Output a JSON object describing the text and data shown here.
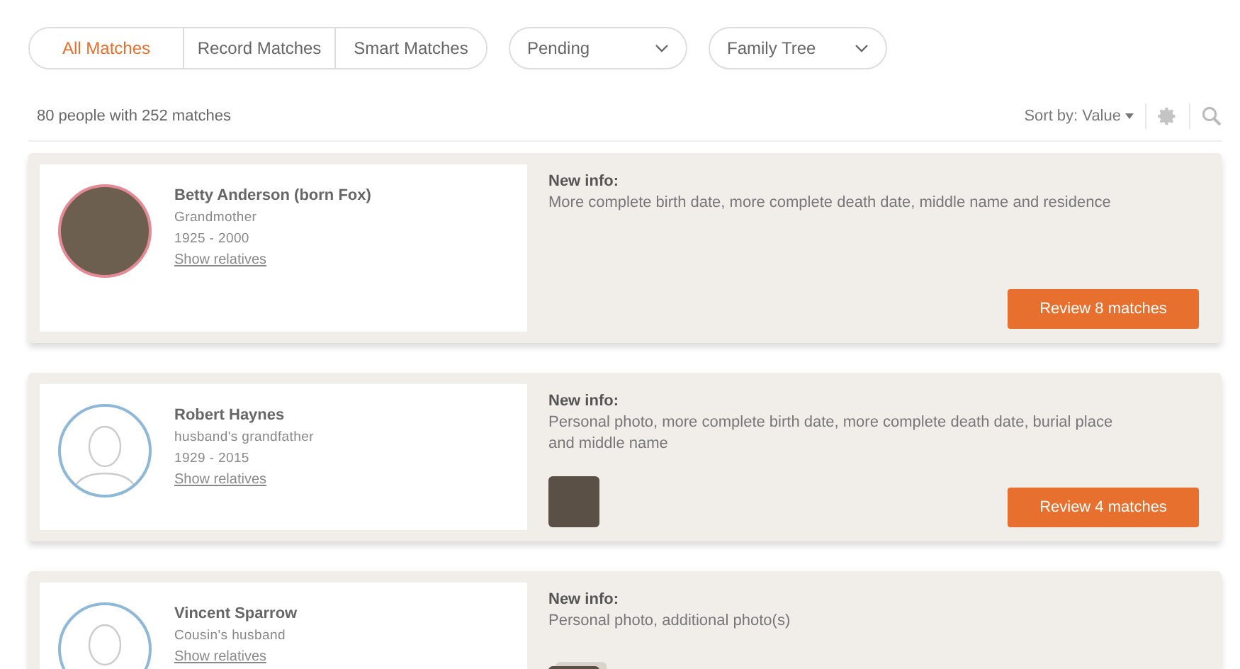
{
  "filter_tabs": [
    {
      "label": "All Matches",
      "selected": true
    },
    {
      "label": "Record Matches",
      "selected": false
    },
    {
      "label": "Smart Matches",
      "selected": false
    }
  ],
  "dropdowns": [
    {
      "label": "Pending"
    },
    {
      "label": "Family Tree"
    }
  ],
  "summary": "80 people with 252 matches",
  "sort": {
    "label": "Sort by:",
    "value": "Value"
  },
  "matches": [
    {
      "name": "Betty Anderson (born Fox)",
      "relation": "Grandmother",
      "years": "1925 - 2000",
      "link": "Show relatives",
      "kind": "photo",
      "info_title": "New info:",
      "info": "More complete birth date, more complete death date, middle name and residence",
      "button": "Review 8 matches"
    },
    {
      "name": "Robert Haynes",
      "relation": "husband's grandfather",
      "years": "1929 - 2015",
      "link": "Show relatives",
      "kind": "silhouette",
      "info_title": "New info:",
      "info": "Personal photo, more complete birth date, more complete death date, burial place and middle name",
      "thumbnail": {
        "kind": "single"
      },
      "button": "Review 4 matches"
    },
    {
      "name": "Vincent Sparrow",
      "relation": "Cousin's husband",
      "link": "Show relatives",
      "kind": "silhouette",
      "info_title": "New info:",
      "info": "Personal photo, additional photo(s)",
      "thumbnail": {
        "kind": "stack"
      }
    }
  ]
}
